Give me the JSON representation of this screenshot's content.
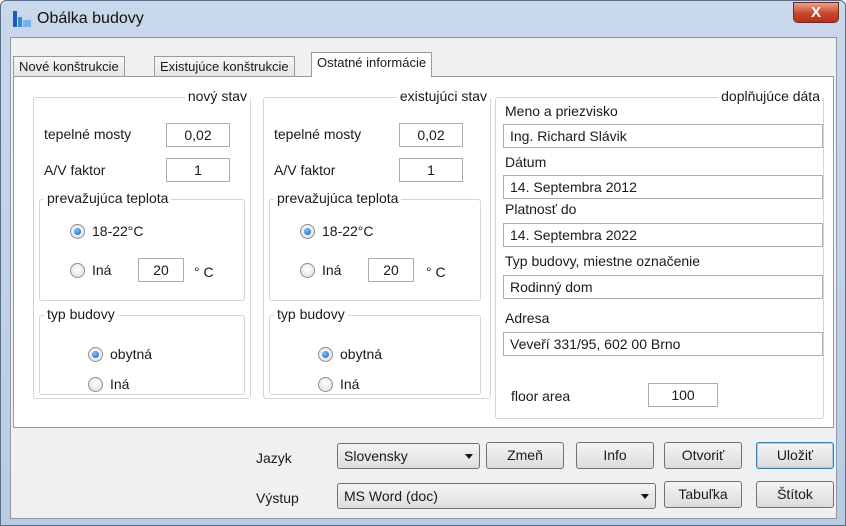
{
  "window": {
    "title": "Obálka budovy",
    "close_label": "X"
  },
  "tabs": [
    {
      "label": "Nové konštrukcie"
    },
    {
      "label": "Existujúce konštrukcie"
    },
    {
      "label": "Ostatné informácie"
    }
  ],
  "new_state": {
    "title": "nový stav",
    "thermal_bridges_label": "tepelné mosty",
    "thermal_bridges_value": "0,02",
    "av_factor_label": "A/V faktor",
    "av_factor_value": "1",
    "temperature": {
      "title": "prevažujúca teplota",
      "option1": "18-22°C",
      "option2": "Iná",
      "other_value": "20",
      "unit": "° C",
      "selected": "option1"
    },
    "building_type": {
      "title": "typ budovy",
      "option1": "obytná",
      "option2": "Iná",
      "selected": "option1"
    }
  },
  "existing_state": {
    "title": "existujúci stav",
    "thermal_bridges_label": "tepelné mosty",
    "thermal_bridges_value": "0,02",
    "av_factor_label": "A/V faktor",
    "av_factor_value": "1",
    "temperature": {
      "title": "prevažujúca teplota",
      "option1": "18-22°C",
      "option2": "Iná",
      "other_value": "20",
      "unit": "° C",
      "selected": "option1"
    },
    "building_type": {
      "title": "typ budovy",
      "option1": "obytná",
      "option2": "Iná",
      "selected": "option1"
    }
  },
  "extra": {
    "title": "doplňujúce dáta",
    "name_label": "Meno a priezvisko",
    "name_value": "Ing. Richard Slávik",
    "date_label": "Dátum",
    "date_value": "14. Septembra 2012",
    "valid_label": "Platnosť do",
    "valid_value": "14. Septembra 2022",
    "type_label": "Typ budovy, miestne označenie",
    "type_value": "Rodinný dom",
    "address_label": "Adresa",
    "address_value": "Veveří 331/95, 602 00 Brno",
    "floor_area_label": "floor area",
    "floor_area_value": "100"
  },
  "bottom": {
    "language_label": "Jazyk",
    "language_value": "Slovensky",
    "change_button": "Zmeň",
    "info_button": "Info",
    "open_button": "Otvoriť",
    "save_button": "Uložiť",
    "output_label": "Výstup",
    "output_value": "MS Word (doc)",
    "table_button": "Tabuľka",
    "label_button": "Štítok"
  }
}
